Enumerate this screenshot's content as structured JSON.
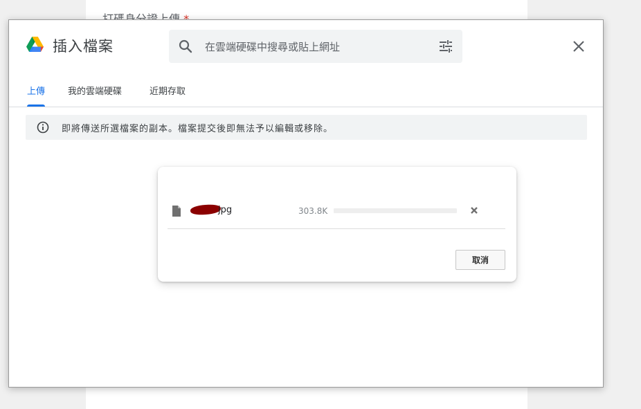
{
  "background": {
    "field_label": "打碼身分證上傳",
    "required_mark": "*"
  },
  "dialog": {
    "title": "插入檔案",
    "logo_icon": "google-drive-icon",
    "search": {
      "placeholder": "在雲端硬碟中搜尋或貼上網址",
      "value": "",
      "icon": "search-icon",
      "options_icon": "tune-icon"
    },
    "close_icon": "close-icon",
    "tabs": [
      {
        "label": "上傳",
        "active": true
      },
      {
        "label": "我的雲端硬碟",
        "active": false
      },
      {
        "label": "近期存取",
        "active": false
      }
    ],
    "notice": {
      "icon": "info-icon",
      "text": "即將傳送所選檔案的副本。檔案提交後即無法予以編輯或移除。"
    },
    "upload": {
      "file_icon": "file-icon",
      "file_name_visible": "jpg",
      "file_size": "303.8K",
      "progress": 0,
      "remove_icon": "close-icon",
      "cancel_label": "取消"
    }
  },
  "colors": {
    "accent": "#1a73e8",
    "text_primary": "#3c4043",
    "notice_bg": "#f1f3f4",
    "redaction": "#8b0000"
  }
}
